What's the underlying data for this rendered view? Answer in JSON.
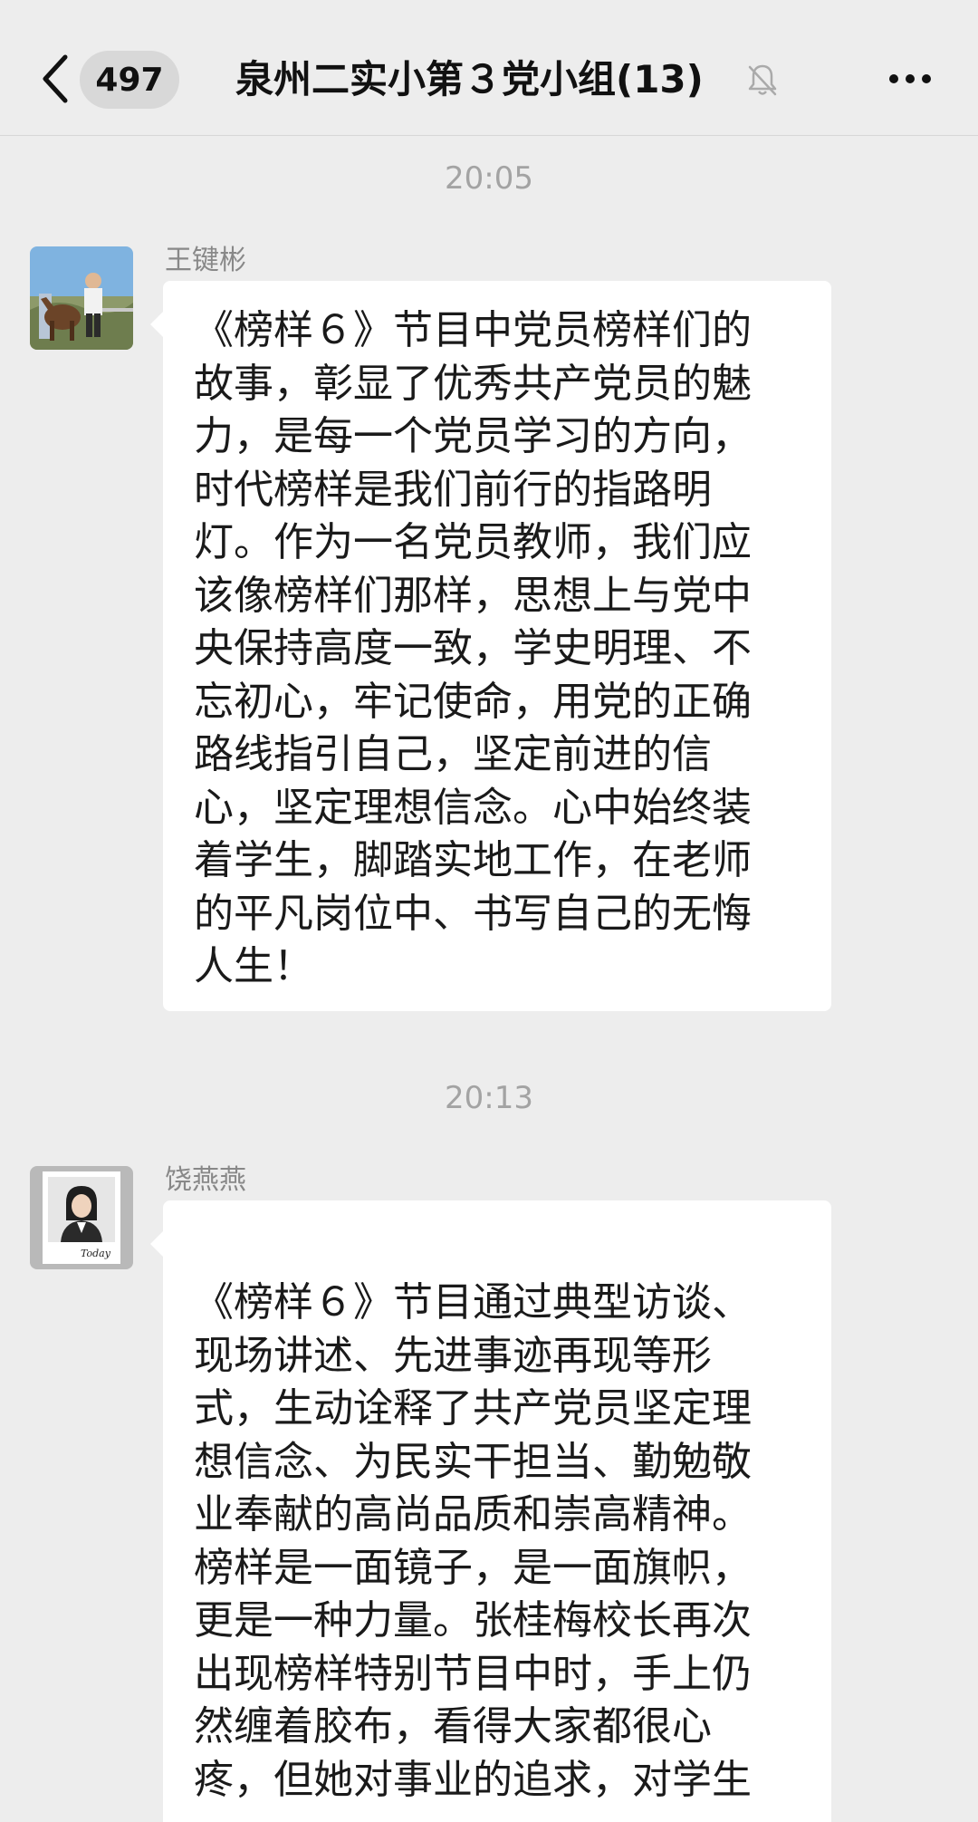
{
  "header": {
    "back_label": "back",
    "unread_count": "497",
    "title": "泉州二实小第３党小组(13)",
    "mute_icon": "bell-mute-icon",
    "more_icon": "more-dots-icon"
  },
  "messages": [
    {
      "time": "20:05",
      "sender": "王键彬",
      "avatar": "avatar-photo-man-horse",
      "lines": [
        "《榜样６》节目中党员榜样们的",
        "故事，彰显了优秀共产党员的魅",
        "力，是每一个党员学习的方向，",
        "时代榜样是我们前行的指路明",
        "灯。作为一名党员教师，我们应",
        "该像榜样们那样，思想上与党中",
        "央保持高度一致，学史明理、不",
        "忘初心，牢记使命，用党的正确",
        "路线指引自己，坚定前进的信",
        "心，坚定理想信念。心中始终装",
        "着学生，脚踏实地工作，在老师",
        "的平凡岗位中、书写自己的无悔",
        "人生！"
      ]
    },
    {
      "time": "20:13",
      "sender": "饶燕燕",
      "avatar": "avatar-photo-woman-today",
      "lines": [
        "《榜样６》节目通过典型访谈、",
        "现场讲述、先进事迹再现等形",
        "式，生动诠释了共产党员坚定理",
        "想信念、为民实干担当、勤勉敬",
        "业奉献的高尚品质和崇高精神。",
        "榜样是一面镜子，是一面旗帜，",
        "更是一种力量。张桂梅校长再次",
        "出现榜样特别节目中时，手上仍",
        "然缠着胶布，看得大家都很心",
        "疼，但她对事业的追求，对学生"
      ]
    }
  ]
}
